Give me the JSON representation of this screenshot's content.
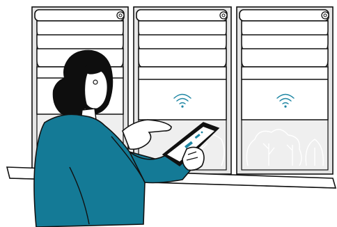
{
  "illustration": {
    "windows_count": 3,
    "blinds": {
      "style": "roman-shade",
      "state": "partially-lowered"
    },
    "wireless_indicators": 2,
    "person": {
      "action": "controlling-smart-blinds-with-tablet"
    },
    "device": {
      "type": "tablet"
    }
  },
  "colors": {
    "outline": "#111111",
    "shade_fill": "#ffffff",
    "window_gray": "#e6e6e6",
    "glass_gray": "#efefef",
    "jacket": "#147a96",
    "hair": "#0e0e0e",
    "wifi": "#1e86a3",
    "sill": "#ffffff"
  }
}
